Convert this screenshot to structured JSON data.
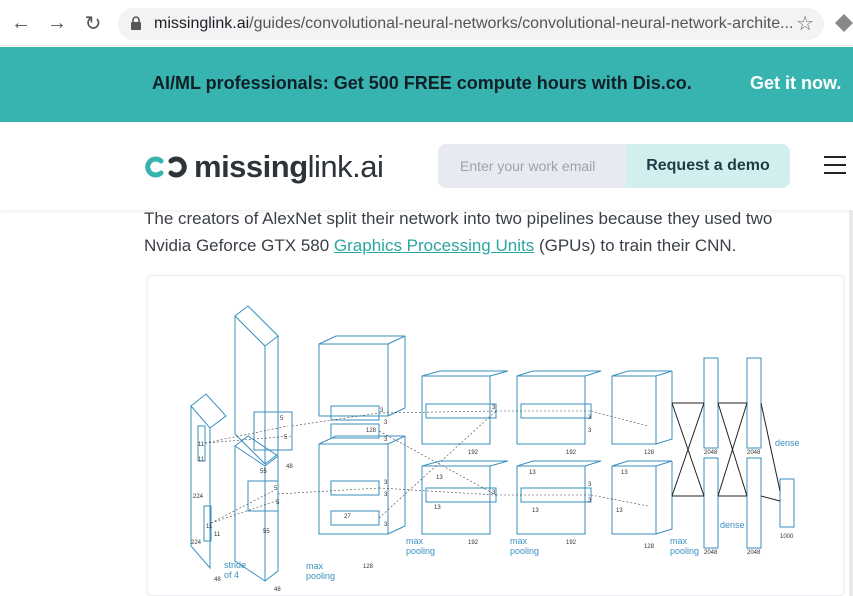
{
  "browser": {
    "url_host": "missinglink.ai",
    "url_path": "/guides/convolutional-neural-networks/convolutional-neural-network-archite..."
  },
  "promo": {
    "text": "AI/ML professionals: Get 500 FREE compute hours with Dis.co.",
    "link": "Get it now."
  },
  "header": {
    "logo_bold": "missing",
    "logo_light": "link.ai",
    "email_placeholder": "Enter your work email",
    "demo_button": "Request a demo"
  },
  "article": {
    "text_before": "The creators of AlexNet split their network into two pipelines because they used two Nvidia Geforce GTX 580 ",
    "link": "Graphics Processing Units",
    "text_after": " (GPUs) to train their CNN."
  },
  "figure": {
    "labels": {
      "k11a": "11",
      "k11b": "11",
      "in224a": "224",
      "in224b": "224",
      "in3": "3",
      "stride": "stride",
      "of4": "of 4",
      "k11c": "11",
      "k11d": "11",
      "k48": "48",
      "c1_55a": "55",
      "c1_55b": "55",
      "c1_48a": "48",
      "c1_48b": "48",
      "k5a": "5",
      "k5b": "5",
      "k5c": "5",
      "k5d": "5",
      "c2_27": "27",
      "c2_128a": "128",
      "c2_128b": "128",
      "k3a": "3",
      "k3b": "3",
      "k3c": "3",
      "k3d": "3",
      "k3e": "3",
      "k3f": "3",
      "k3g": "3",
      "k3h": "3",
      "c3_13a": "13",
      "c3_13b": "13",
      "c3_192a": "192",
      "c3_192b": "192",
      "c4_13a": "13",
      "c4_13b": "13",
      "c4_192a": "192",
      "c4_192b": "192",
      "k3i": "3",
      "k3j": "3",
      "k3k": "3",
      "k3l": "3",
      "c5_13a": "13",
      "c5_13b": "13",
      "c5_128a": "128",
      "c5_128b": "128",
      "fc_2048a": "2048",
      "fc_2048b": "2048",
      "fc_2048c": "2048",
      "fc_2048d": "2048",
      "out_1000": "1000",
      "max": "max",
      "pooling": "pooling",
      "max2": "max",
      "pooling2": "pooling",
      "max3": "max",
      "pooling3": "pooling",
      "max4": "max",
      "pooling4": "pooling",
      "dense1": "dense",
      "dense2": "dense"
    }
  }
}
